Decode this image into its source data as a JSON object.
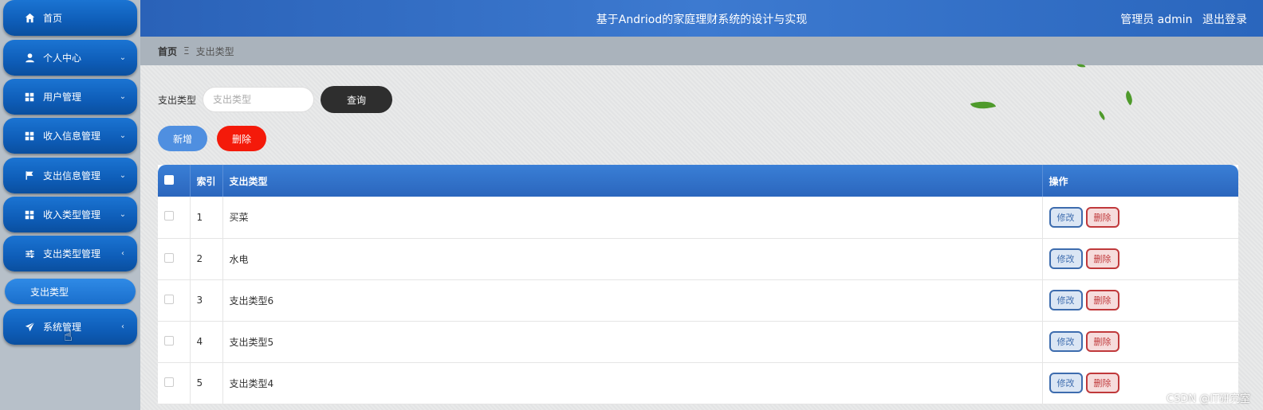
{
  "header": {
    "title": "基于Andriod的家庭理财系统的设计与实现",
    "role": "管理员 admin",
    "logout": "退出登录"
  },
  "sidebar": {
    "items": [
      {
        "label": "首页",
        "icon": "home-icon"
      },
      {
        "label": "个人中心",
        "icon": "user-icon",
        "arrow": "⌄"
      },
      {
        "label": "用户管理",
        "icon": "grid-icon",
        "arrow": "⌄"
      },
      {
        "label": "收入信息管理",
        "icon": "grid-icon",
        "arrow": "⌄"
      },
      {
        "label": "支出信息管理",
        "icon": "flag-icon",
        "arrow": "⌄"
      },
      {
        "label": "收入类型管理",
        "icon": "grid-icon",
        "arrow": "⌄"
      },
      {
        "label": "支出类型管理",
        "icon": "sliders-icon",
        "arrow": "‹"
      },
      {
        "label": "系统管理",
        "icon": "paper-plane-icon",
        "arrow": "‹"
      }
    ],
    "submenu": {
      "label": "支出类型"
    }
  },
  "breadcrumb": {
    "home": "首页",
    "separator": "Ξ",
    "current": "支出类型"
  },
  "search": {
    "label": "支出类型",
    "placeholder": "支出类型",
    "query_button": "查询"
  },
  "actions": {
    "add": "新增",
    "delete": "删除"
  },
  "table": {
    "columns": [
      "索引",
      "支出类型",
      "操作"
    ],
    "rows": [
      {
        "index": "1",
        "type": "买菜"
      },
      {
        "index": "2",
        "type": "水电"
      },
      {
        "index": "3",
        "type": "支出类型6"
      },
      {
        "index": "4",
        "type": "支出类型5"
      },
      {
        "index": "5",
        "type": "支出类型4"
      }
    ],
    "edit_label": "修改",
    "delete_label": "删除"
  },
  "watermark": "CSDN @IT研究室",
  "colors": {
    "primary": "#1b74d3",
    "header": "#2a62b8",
    "add_button": "#4f8fe0",
    "delete_button": "#f41a0a",
    "query_button": "#2e2e2e"
  }
}
